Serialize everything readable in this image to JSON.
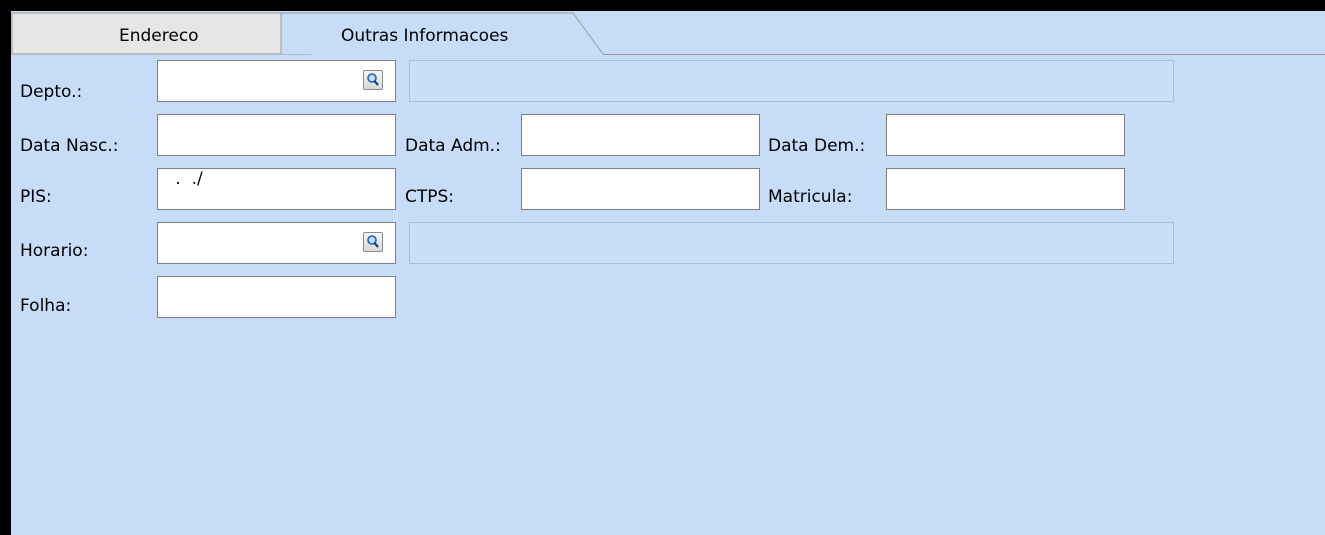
{
  "tabs": [
    {
      "label": "Endereco",
      "active": false
    },
    {
      "label": "Outras Informacoes",
      "active": true
    }
  ],
  "form": {
    "depto": {
      "label": "Depto.:",
      "value": "",
      "description": ""
    },
    "data_nasc": {
      "label": "Data Nasc.:",
      "value": ""
    },
    "data_adm": {
      "label": "Data Adm.:",
      "value": ""
    },
    "data_dem": {
      "label": "Data Dem.:",
      "value": ""
    },
    "pis": {
      "label": "PIS:",
      "mask": " .  ./"
    },
    "ctps": {
      "label": "CTPS:",
      "value": ""
    },
    "matricula": {
      "label": "Matricula:",
      "value": ""
    },
    "horario": {
      "label": "Horario:",
      "value": "",
      "description": ""
    },
    "folha": {
      "label": "Folha:",
      "value": ""
    }
  },
  "icons": {
    "lookup": "magnifier-icon"
  },
  "colors": {
    "panel": "#c6dcf7",
    "frame": "#000000",
    "input_bg": "#ffffff",
    "disabled_bg": "#c9def8"
  }
}
